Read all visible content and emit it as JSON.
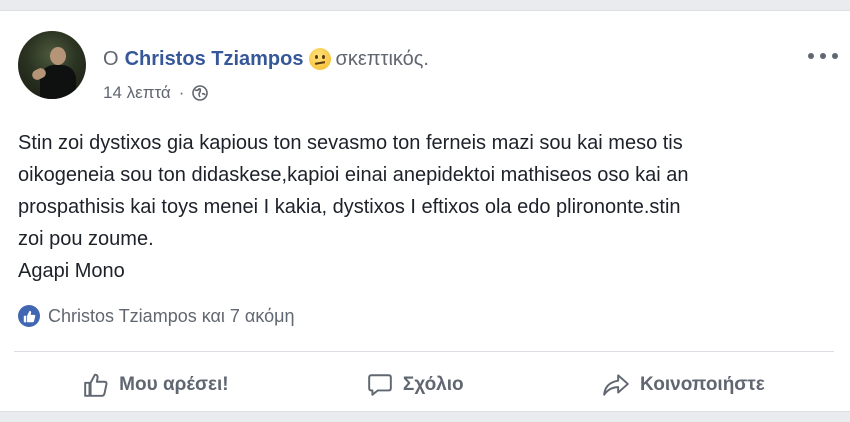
{
  "post": {
    "author_prefix": "Ο",
    "author_name": "Christos Tziampos",
    "feeling_icon": "thinking-face-emoji",
    "feeling_text": "σκεπτικός.",
    "time": "14 λεπτά",
    "separator": "·",
    "audience_icon": "globe-icon",
    "text_lines": [
      "Stin zoi dystixos gia kapious ton sevasmo ton ferneis mazi sou kai meso tis",
      "oikogeneia sou ton didaskese,kapioi einai anepidektoi mathiseos oso kai an",
      "prospathisis kai toys menei I kakia, dystixos I eftixos ola edo plirononte.stin",
      "zoi pou zoume.",
      "Agapi Mono"
    ]
  },
  "reactions": {
    "icon": "like-icon",
    "summary": "Christos Tziampos και 7 ακόμη"
  },
  "actions": {
    "like_label": "Μου αρέσει!",
    "comment_label": "Σχόλιο",
    "share_label": "Κοινοποιήστε"
  },
  "colors": {
    "link_blue": "#365899",
    "like_blue": "#4267b2",
    "muted_text": "#616770",
    "background": "#e9ebee"
  }
}
